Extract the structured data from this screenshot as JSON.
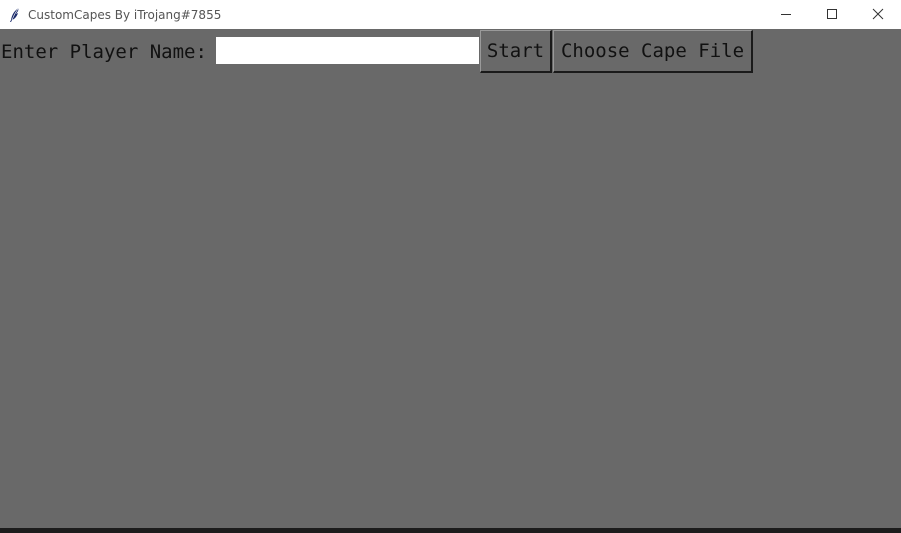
{
  "window": {
    "title": "CustomCapes By iTrojang#7855",
    "icon": "feather-icon",
    "controls": [
      "minimize-icon",
      "maximize-icon",
      "close-icon"
    ]
  },
  "form": {
    "name_label": "Enter Player Name:",
    "name_value": "",
    "start_label": "Start",
    "choose_label": "Choose Cape File"
  },
  "colors": {
    "background": "#696969",
    "titlebar": "#ffffff",
    "text": "#111111"
  }
}
